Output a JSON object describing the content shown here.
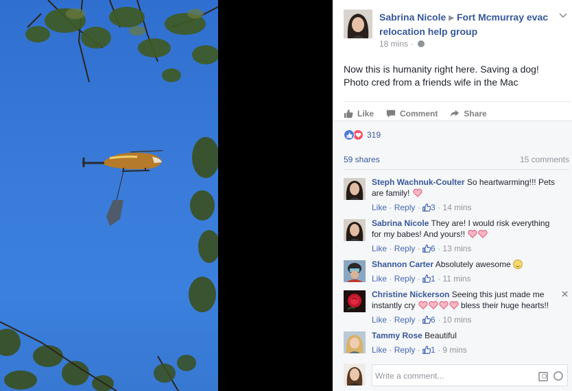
{
  "post": {
    "author": "Sabrina Nicole",
    "group": "Fort Mcmurray evac relocation help group",
    "time": "18 mins",
    "separator": "·",
    "text": "Now this is humanity right here. Saving a dog!\nPhoto cred from a friends wife in the Mac"
  },
  "actions": {
    "like": "Like",
    "comment": "Comment",
    "share": "Share"
  },
  "stats": {
    "reactions": "319",
    "shares": "59 shares",
    "comments": "15 comments"
  },
  "comments": [
    {
      "name": "Steph Wachnuk-Coulter",
      "text": "So heartwarming!!! Pets are family!",
      "hearts": 1,
      "smile": false,
      "trailing": "",
      "likes": "3",
      "time": "14 mins"
    },
    {
      "name": "Sabrina Nicole",
      "text": "They are! I would risk everything for my babes! And yours!!",
      "hearts": 2,
      "smile": false,
      "trailing": "",
      "likes": "6",
      "time": "13 mins"
    },
    {
      "name": "Shannon Carter",
      "text": "Absolutely awesome",
      "hearts": 0,
      "smile": true,
      "trailing": "",
      "likes": "1",
      "time": "11 mins"
    },
    {
      "name": "Christine Nickerson",
      "text": "Seeing this just made me instantly cry",
      "hearts": 4,
      "smile": false,
      "trailing": "bless their huge hearts!!",
      "likes": "6",
      "time": "10 mins"
    },
    {
      "name": "Tammy Rose",
      "text": "Beautiful",
      "hearts": 0,
      "smile": false,
      "trailing": "",
      "likes": "1",
      "time": "9 mins"
    }
  ],
  "comment_actions": {
    "like": "Like",
    "reply": "Reply",
    "dot": " · "
  },
  "composer": {
    "placeholder": "Write a comment..."
  },
  "icons": {
    "author_arrow": "▶",
    "options": "chevron-down-icon",
    "close": "✕"
  },
  "colors": {
    "link": "#365899",
    "meta": "#90949c",
    "like_blue": "#4c78d6",
    "love_red": "#f25268",
    "sky": "#3a7bd9"
  }
}
